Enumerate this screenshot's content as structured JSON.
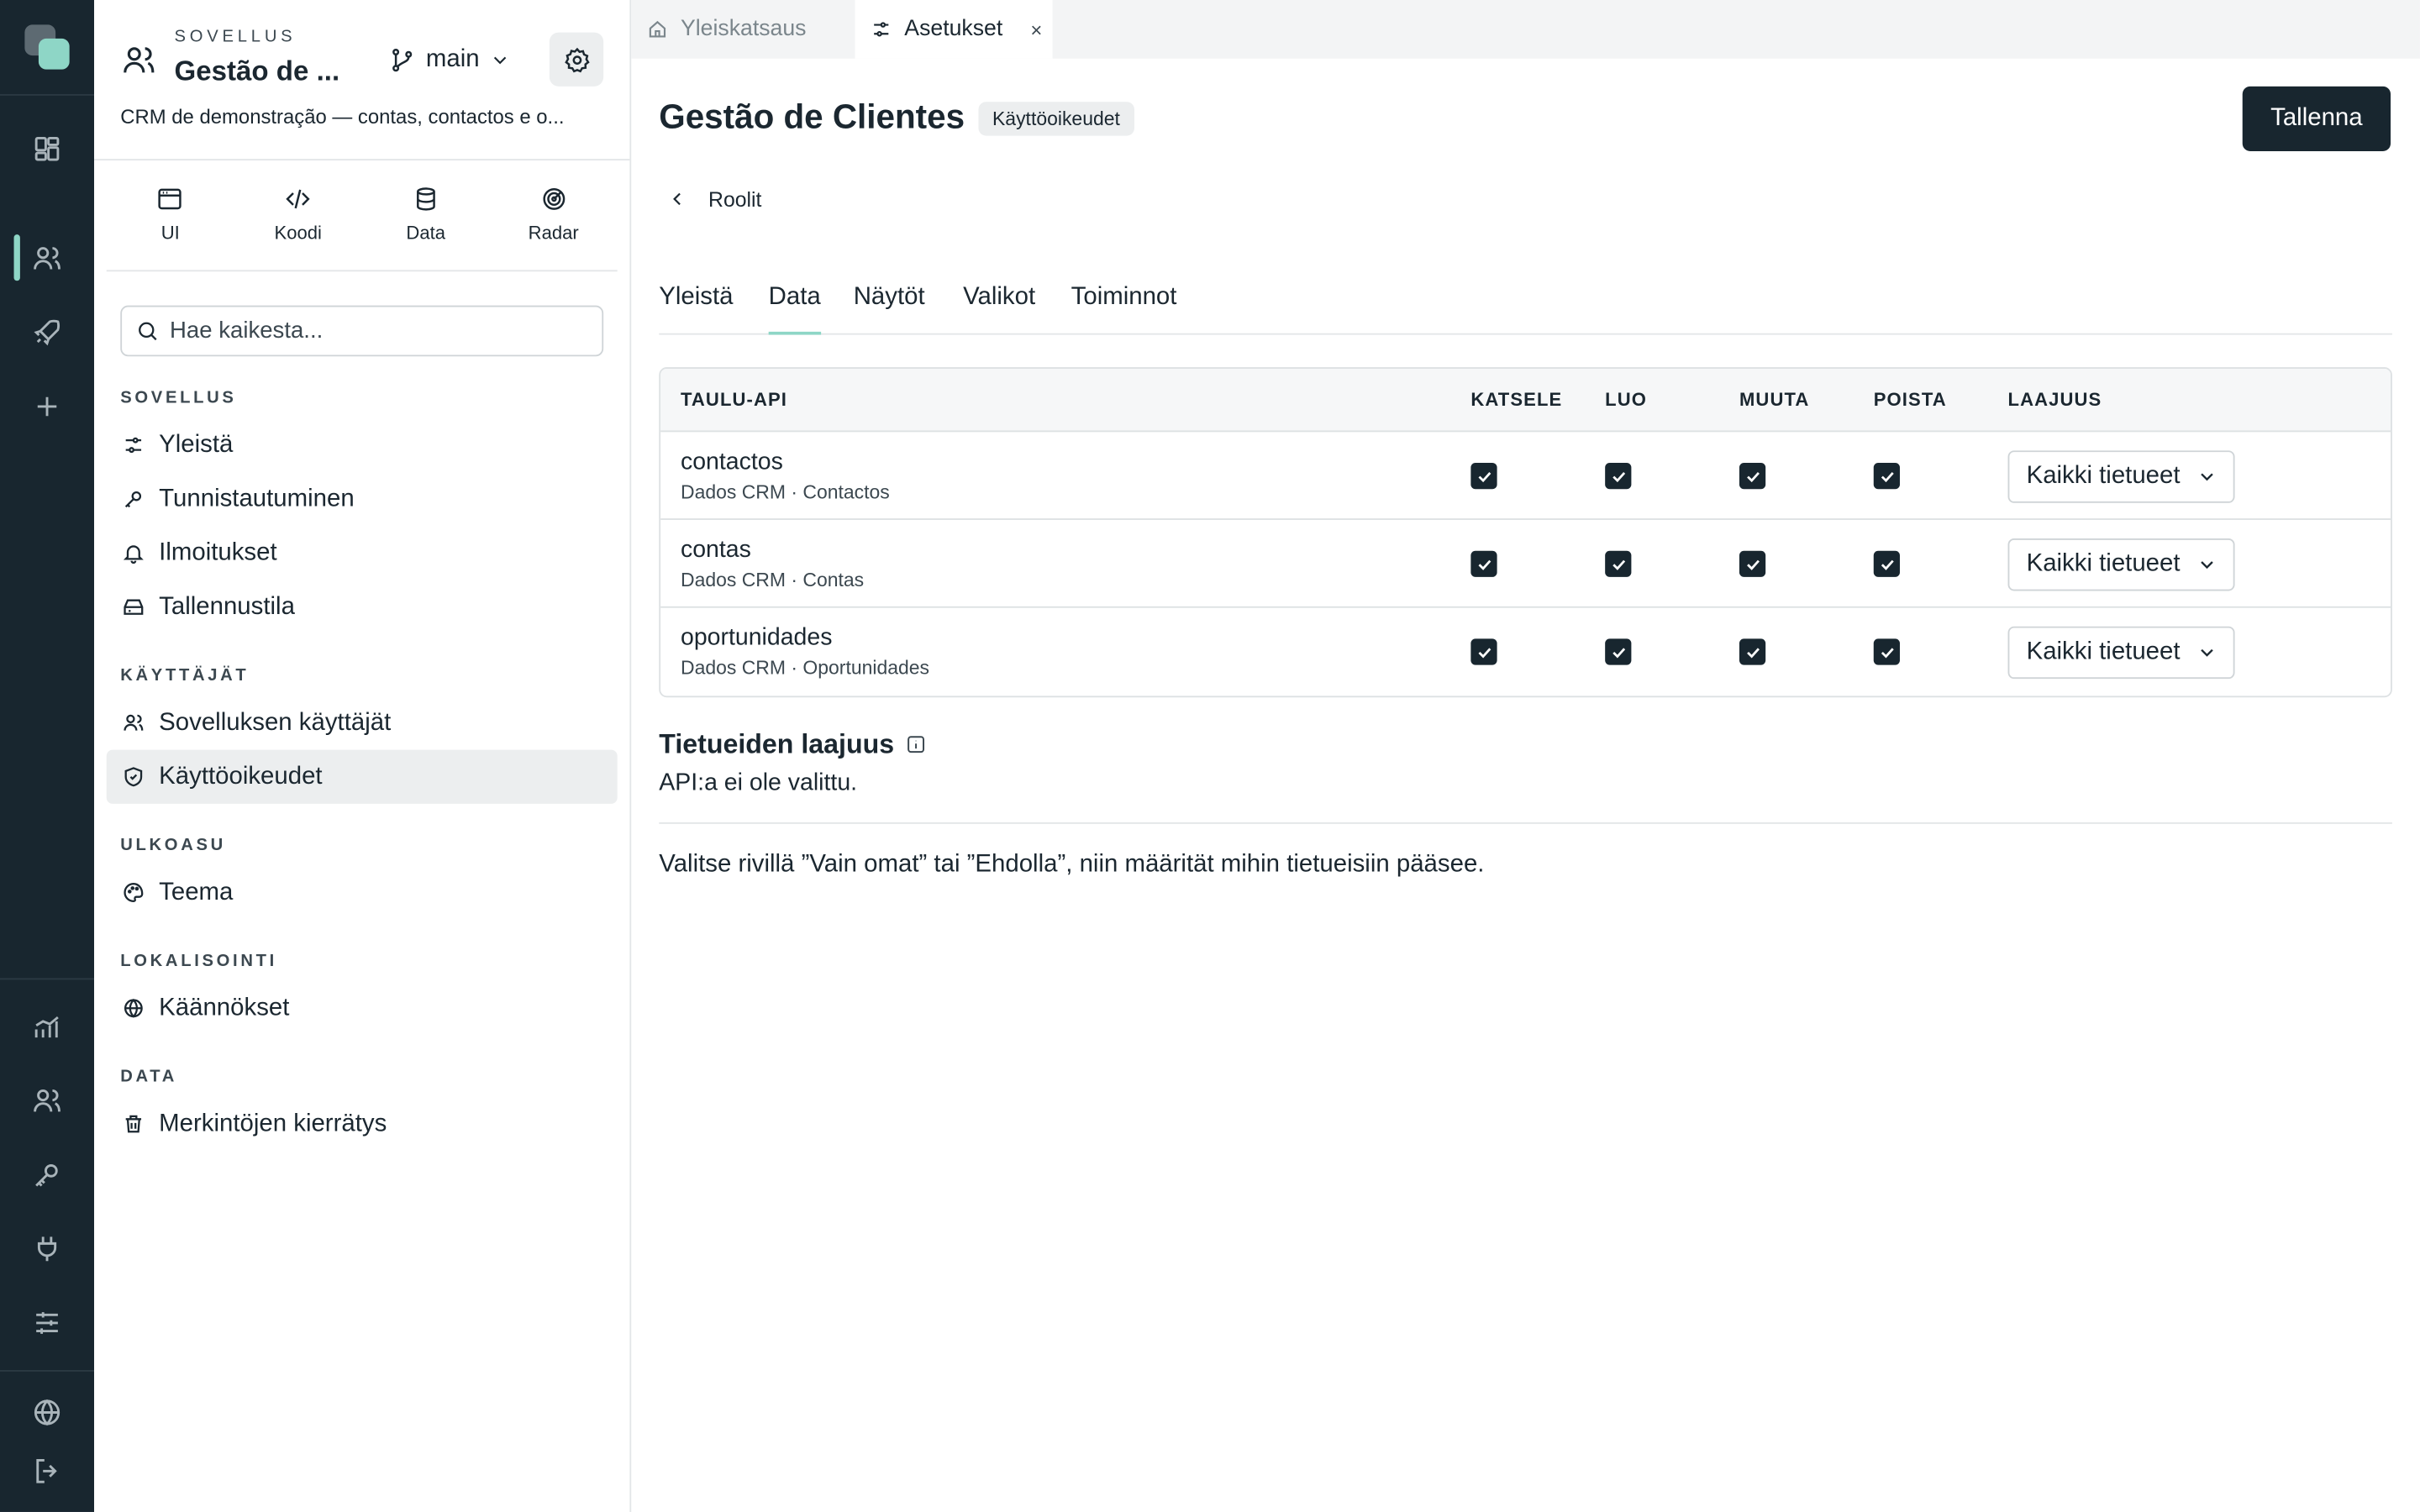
{
  "rail": {
    "items": [
      "apps-icon",
      "users-icon",
      "rocket-icon",
      "plus-icon",
      "chart-icon",
      "people-icon",
      "key-icon",
      "plug-icon",
      "sliders-icon",
      "globe-icon",
      "logout-icon"
    ]
  },
  "app": {
    "eyebrow": "SOVELLUS",
    "name": "Gestão de ...",
    "branch": "main",
    "description": "CRM de demonstração — contas, contactos e o..."
  },
  "modes": [
    {
      "label": "UI",
      "icon": "browser-icon"
    },
    {
      "label": "Koodi",
      "icon": "code-icon"
    },
    {
      "label": "Data",
      "icon": "database-icon"
    },
    {
      "label": "Radar",
      "icon": "radar-icon"
    }
  ],
  "search": {
    "placeholder": "Hae kaikesta..."
  },
  "nav": {
    "sections": [
      {
        "title": "SOVELLUS",
        "items": [
          "Yleistä",
          "Tunnistautuminen",
          "Ilmoitukset",
          "Tallennustila"
        ]
      },
      {
        "title": "KÄYTTÄJÄT",
        "items": [
          "Sovelluksen käyttäjät",
          "Käyttöoikeudet"
        ]
      },
      {
        "title": "ULKOASU",
        "items": [
          "Teema"
        ]
      },
      {
        "title": "LOKALISOINTI",
        "items": [
          "Käännökset"
        ]
      },
      {
        "title": "DATA",
        "items": [
          "Merkintöjen kierrätys"
        ]
      }
    ],
    "active": "Käyttöoikeudet"
  },
  "window_tabs": [
    {
      "label": "Yleiskatsaus",
      "icon": "home-icon"
    },
    {
      "label": "Asetukset",
      "icon": "settings-sliders-icon",
      "close": "×"
    }
  ],
  "page": {
    "title": "Gestão de Clientes",
    "badge": "Käyttöoikeudet",
    "save_label": "Tallenna",
    "back_label": "Roolit"
  },
  "tabs": [
    "Yleistä",
    "Data",
    "Näytöt",
    "Valikot",
    "Toiminnot"
  ],
  "active_tab": "Data",
  "table": {
    "headers": [
      "TAULU-API",
      "KATSELE",
      "LUO",
      "MUUTA",
      "POISTA",
      "LAAJUUS"
    ],
    "rows": [
      {
        "name": "contactos",
        "sub": "Dados CRM · Contactos",
        "view": true,
        "create": true,
        "edit": true,
        "delete": true,
        "scope": "Kaikki tietueet"
      },
      {
        "name": "contas",
        "sub": "Dados CRM · Contas",
        "view": true,
        "create": true,
        "edit": true,
        "delete": true,
        "scope": "Kaikki tietueet"
      },
      {
        "name": "oportunidades",
        "sub": "Dados CRM · Oportunidades",
        "view": true,
        "create": true,
        "edit": true,
        "delete": true,
        "scope": "Kaikki tietueet"
      }
    ]
  },
  "scope_section": {
    "title": "Tietueiden laajuus",
    "empty": "API:a ei ole valittu.",
    "hint": "Valitse rivillä ”Vain omat” tai ”Ehdolla”, niin määrität mihin tietueisiin pääsee."
  },
  "colors": {
    "rail_bg": "#18262f",
    "accent": "#8ed6c6",
    "primary_button": "#18262f"
  }
}
